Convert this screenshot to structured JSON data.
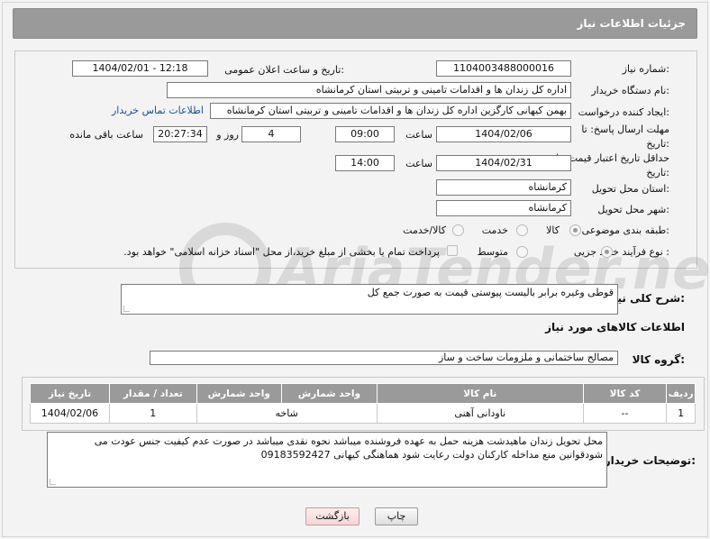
{
  "header": {
    "title": "جزئیات اطلاعات نیاز"
  },
  "form": {
    "need_number": {
      "label": "شماره نیاز:",
      "value": "1104003488000016"
    },
    "announce_datetime": {
      "label": "تاریخ و ساعت اعلان عمومی:",
      "value": "1404/02/01 - 12:18"
    },
    "buyer_org": {
      "label": "نام دستگاه خریدار:",
      "value": "اداره کل زندان ها و اقدامات تامینی و تربیتی استان کرمانشاه"
    },
    "requester": {
      "label": "ایجاد کننده درخواست:",
      "value": "بهمن کیهانی کارگزین اداره کل زندان ها و اقدامات تامینی و تربیتی استان کرمانشاه",
      "contact_link": "اطلاعات تماس خریدار"
    },
    "reply_deadline": {
      "label": "مهلت ارسال پاسخ: تا تاریخ:",
      "date": "1404/02/06",
      "time_label": "ساعت",
      "time": "09:00",
      "days": "4",
      "days_label": "روز و",
      "remaining": "20:27:34",
      "remaining_label": "ساعت باقی مانده"
    },
    "price_validity": {
      "label": "حداقل تاریخ اعتبار قیمت: تا تاریخ:",
      "date": "1404/02/31",
      "time_label": "ساعت",
      "time": "14:00"
    },
    "delivery_province": {
      "label": "استان محل تحویل:",
      "value": "کرمانشاه"
    },
    "delivery_city": {
      "label": "شهر محل تحویل:",
      "value": "کرمانشاه"
    },
    "category": {
      "label": "طبقه بندی موضوعی:",
      "options": [
        "کالا",
        "خدمت",
        "کالا/خدمت"
      ],
      "selected": "کالا"
    },
    "purchase_process": {
      "label": "نوع فرآیند خرید :",
      "options": [
        "جزیی",
        "متوسط"
      ],
      "selected": "جزیی",
      "note": "پرداخت تمام یا بخشی از مبلغ خرید،از محل \"اسناد خزانه اسلامی\" خواهد بود."
    }
  },
  "description": {
    "label": "شرح کلی نیاز:",
    "value": "قوطی وغیره برابر بالیست پیوستی قیمت به صورت جمع کل"
  },
  "goods_section": {
    "title": "اطلاعات کالاهای مورد نیاز"
  },
  "goods_group": {
    "label": "گروه کالا:",
    "value": "مصالح ساختمانی و ملزومات ساخت و ساز"
  },
  "goods_table": {
    "columns": [
      "ردیف",
      "کد کالا",
      "نام کالا",
      "واحد شمارش",
      "تعداد / مقدار",
      "تاریخ نیاز"
    ],
    "rows": [
      [
        "1",
        "--",
        "ناودانی آهنی",
        "شاخه",
        "1",
        "1404/02/06"
      ]
    ]
  },
  "buyer_notes": {
    "label": "توضیحات خریدار:",
    "value": "محل تحویل زندان ماهیدشت هزینه حمل به عهده فروشنده میباشد نحوه نقدی میباشد در صورت عدم کیفیت جنس عودت می شودقوانین منع مداخله کارکنان دولت رعایت شود هماهنگی کیهانی  09183592427"
  },
  "buttons": {
    "print": "چاپ",
    "back": "بازگشت"
  },
  "watermark": {
    "text": "AriaTender.net"
  }
}
